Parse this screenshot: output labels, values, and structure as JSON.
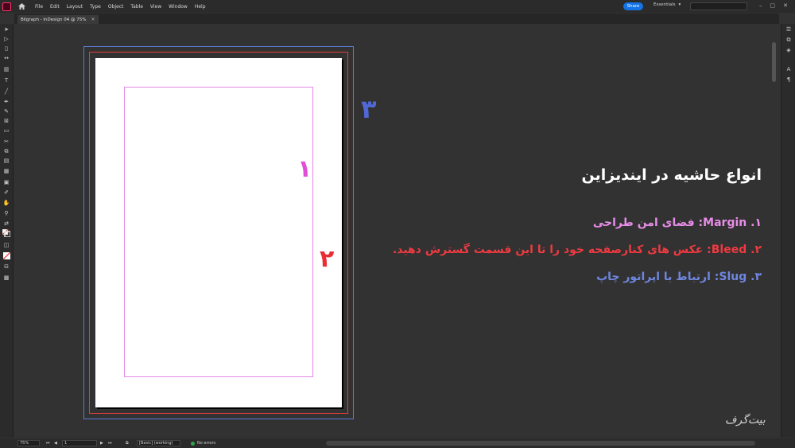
{
  "menubar": {
    "items": [
      "File",
      "Edit",
      "Layout",
      "Type",
      "Object",
      "Table",
      "View",
      "Window",
      "Help"
    ],
    "share_label": "Share",
    "workspace_label": "Essentials"
  },
  "tab": {
    "title": "Bilgraph - InDesign 04 @ 75%"
  },
  "canvas": {
    "label_margin": "۱",
    "label_bleed": "۲",
    "label_slug": "۳"
  },
  "info": {
    "title": "انواع حاشیه در ایندیزاین",
    "line1": "۱. Margin: فضای امن طراحی",
    "line2": "۲. Bleed: عکس های کنارصفحه خود را تا این قسمت گسترش دهید.",
    "line3": "۳. Slug: ارتباط با اپراتور چاپ"
  },
  "watermark": "بیت‌گرف",
  "statusbar": {
    "zoom": "75%",
    "page": "1",
    "style": "[Basic] (working)",
    "preflight": "No errors"
  },
  "colors": {
    "margin": "#e58ae8",
    "bleed": "#e0403a",
    "slug": "#5b7bd5",
    "accent": "#1473e6"
  }
}
